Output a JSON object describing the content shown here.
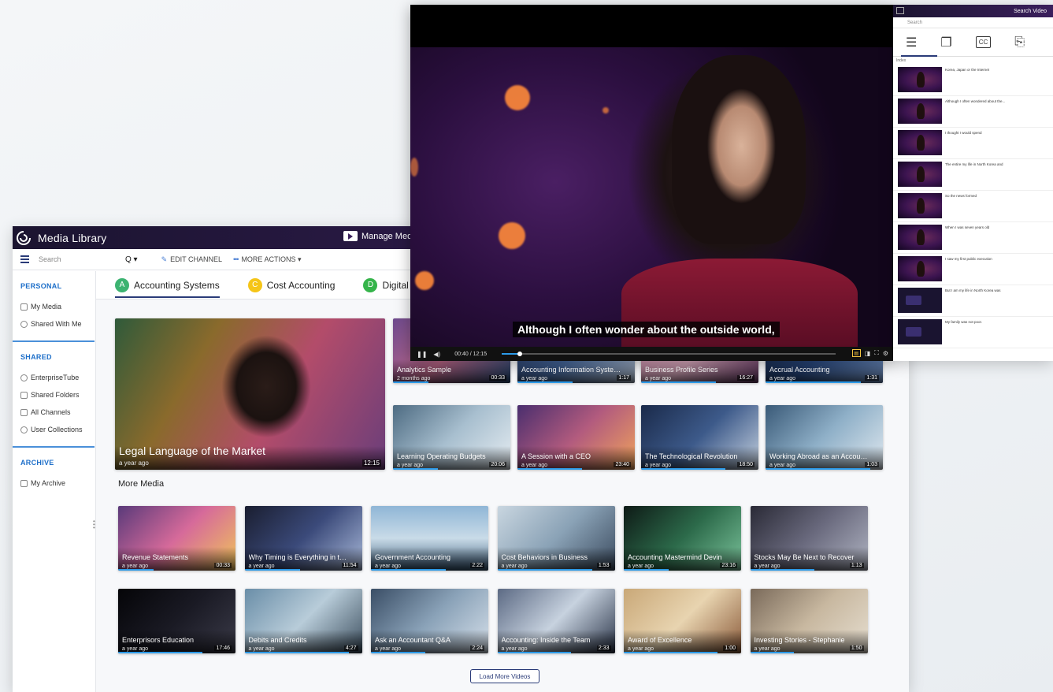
{
  "library": {
    "title": "Media Library",
    "manage_media": "Manage Media",
    "search_placeholder": "Search",
    "search_btn": "Q ▾",
    "edit_channel": "EDIT CHANNEL",
    "more_actions": "MORE ACTIONS ▾",
    "sidebar": {
      "personal_head": "PERSONAL",
      "personal_items": [
        "My Media",
        "Shared With Me"
      ],
      "shared_head": "SHARED",
      "shared_items": [
        "EnterpriseTube",
        "Shared Folders",
        "All Channels",
        "User Collections"
      ],
      "archive_head": "ARCHIVE",
      "archive_items": [
        "My Archive"
      ]
    },
    "tabs": [
      {
        "letter": "A",
        "label": "Accounting Systems",
        "color": "#3cb371"
      },
      {
        "letter": "C",
        "label": "Cost Accounting",
        "color": "#f5c518"
      },
      {
        "letter": "D",
        "label": "Digital Assets",
        "color": "#35b44a"
      }
    ],
    "featured": {
      "title": "Legal Language of the Market",
      "age": "a year ago",
      "duration": "12:15"
    },
    "featured_grid": [
      {
        "title": "Analytics Sample",
        "age": "2 months ago",
        "duration": "00:33"
      },
      {
        "title": "Accounting Information Systems",
        "age": "a year ago",
        "duration": "1:17"
      },
      {
        "title": "Business Profile Series",
        "age": "a year ago",
        "duration": "16:27"
      },
      {
        "title": "Accrual Accounting",
        "age": "a year ago",
        "duration": "1:31"
      },
      {
        "title": "Learning Operating Budgets",
        "age": "a year ago",
        "duration": "20:06"
      },
      {
        "title": "A Session with a CEO",
        "age": "a year ago",
        "duration": "23:40"
      },
      {
        "title": "The Technological Revolution",
        "age": "a year ago",
        "duration": "18:50"
      },
      {
        "title": "Working Abroad as an Accountant",
        "age": "a year ago",
        "duration": "1:03"
      }
    ],
    "more_media_label": "More Media",
    "more_media": [
      {
        "title": "Revenue Statements",
        "age": "a year ago",
        "duration": "00:33"
      },
      {
        "title": "Why Timing is Everything in the Market",
        "age": "a year ago",
        "duration": "11:54"
      },
      {
        "title": "Government Accounting",
        "age": "a year ago",
        "duration": "2:22"
      },
      {
        "title": "Cost Behaviors in Business",
        "age": "a year ago",
        "duration": "1:53"
      },
      {
        "title": "Accounting Mastermind Devin",
        "age": "a year ago",
        "duration": "23:16"
      },
      {
        "title": "Stocks May Be Next to Recover",
        "age": "a year ago",
        "duration": "1:13"
      },
      {
        "title": "Enterprisors Education",
        "age": "a year ago",
        "duration": "17:46"
      },
      {
        "title": "Debits and Credits",
        "age": "a year ago",
        "duration": "4:27"
      },
      {
        "title": "Ask an Accountant Q&A",
        "age": "a year ago",
        "duration": "2:24"
      },
      {
        "title": "Accounting: Inside the Team",
        "age": "a year ago",
        "duration": "2:33"
      },
      {
        "title": "Award of Excellence",
        "age": "a year ago",
        "duration": "1:00"
      },
      {
        "title": "Investing Stories - Stephanie",
        "age": "a year ago",
        "duration": "1:50"
      }
    ],
    "load_more": "Load More Videos"
  },
  "player": {
    "subtitle": "Although I often wonder about the outside world,",
    "time": "00:40 / 12:15",
    "progress": 0.055
  },
  "panel": {
    "title": "Search Video",
    "search_placeholder": "Search",
    "list_label": "Index",
    "entries": [
      "Korea, Japan or the Internet",
      "Although I often wondered about the...",
      "I thought I would spend",
      "The entire my life in North Korea and",
      "So the news formed",
      "When I was seven years old",
      "I saw my first public execution",
      "But I am my life in North Korea was",
      "My family was not poor."
    ]
  },
  "colors": {
    "header": "#2a1a48",
    "accent": "#2c9ae8",
    "nav_blue": "#1e6fc9"
  }
}
